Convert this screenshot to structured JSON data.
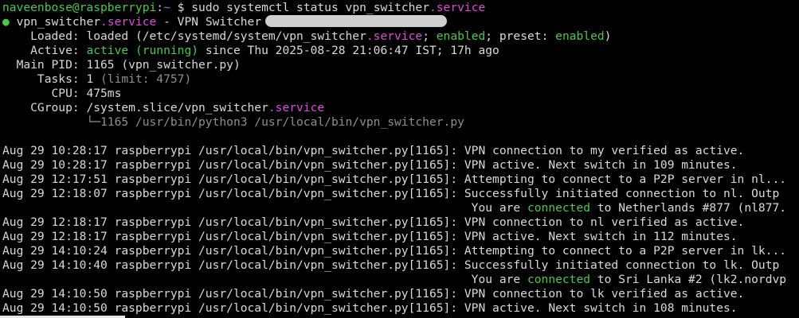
{
  "prompt": {
    "user_host": "naveenbose@raspberrypi",
    "separator": ":",
    "path": "~",
    "symbol": " $ ",
    "command": "sudo systemctl status vpn_switcher",
    "command_suffix": ".service"
  },
  "status": {
    "bullet": "●",
    "unit_name": " vpn_switcher",
    "unit_suffix": ".service",
    "description_prefix": " - VPN Switcher ",
    "loaded_label": "    Loaded: ",
    "loaded_text": "loaded (/etc/systemd/system/vpn_switcher",
    "loaded_suffix": ".service",
    "loaded_sep1": "; ",
    "loaded_enabled": "enabled",
    "loaded_sep2": "; preset: ",
    "loaded_preset": "enabled",
    "loaded_close": ")",
    "active_label": "    Active: ",
    "active_state": "active (running)",
    "active_since": " since Thu 2025-08-28 21:06:47 IST; 17h ago",
    "mainpid_label": "  Main PID: ",
    "mainpid_value": "1165 (vpn_switcher.py)",
    "tasks_label": "     Tasks: ",
    "tasks_value": "1",
    "tasks_limit": " (limit: 4757)",
    "cpu_label": "       CPU: ",
    "cpu_value": "475ms",
    "cgroup_label": "    CGroup: ",
    "cgroup_value": "/system.slice/vpn_switcher",
    "cgroup_suffix": ".service",
    "tree_line": "            └─1165 /usr/bin/python3 /usr/local/bin/vpn_switcher.py"
  },
  "logs": [
    {
      "prefix": "Aug 29 10:28:17 raspberrypi /usr/local/bin/vpn_switcher.py[1165]: ",
      "text": "VPN connection to my verified as active."
    },
    {
      "prefix": "Aug 29 10:28:17 raspberrypi /usr/local/bin/vpn_switcher.py[1165]: ",
      "text": "VPN active. Next switch in 109 minutes."
    },
    {
      "prefix": "Aug 29 12:17:51 raspberrypi /usr/local/bin/vpn_switcher.py[1165]: ",
      "text": "Attempting to connect to a P2P server in nl..."
    },
    {
      "prefix": "Aug 29 12:18:07 raspberrypi /usr/local/bin/vpn_switcher.py[1165]: ",
      "text": "Successfully initiated connection to nl. Outp"
    },
    {
      "cont_prefix": "                                                                   You are ",
      "cont_green": "connected",
      "cont_rest": " to Netherlands #877 (nl877."
    },
    {
      "prefix": "Aug 29 12:18:17 raspberrypi /usr/local/bin/vpn_switcher.py[1165]: ",
      "text": "VPN connection to nl verified as active."
    },
    {
      "prefix": "Aug 29 12:18:17 raspberrypi /usr/local/bin/vpn_switcher.py[1165]: ",
      "text": "VPN active. Next switch in 112 minutes."
    },
    {
      "prefix": "Aug 29 14:10:24 raspberrypi /usr/local/bin/vpn_switcher.py[1165]: ",
      "text": "Attempting to connect to a P2P server in lk..."
    },
    {
      "prefix": "Aug 29 14:10:40 raspberrypi /usr/local/bin/vpn_switcher.py[1165]: ",
      "text": "Successfully initiated connection to lk. Outp"
    },
    {
      "cont_prefix": "                                                                   You are ",
      "cont_green": "connected",
      "cont_rest": " to Sri Lanka #2 (lk2.nordvp"
    },
    {
      "prefix": "Aug 29 14:10:50 raspberrypi /usr/local/bin/vpn_switcher.py[1165]: ",
      "text": "VPN connection to lk verified as active."
    },
    {
      "prefix": "Aug 29 14:10:50 raspberrypi /usr/local/bin/vpn_switcher.py[1165]: ",
      "text": "VPN active. Next switch in 108 minutes."
    }
  ],
  "colors": {
    "background": "#000000",
    "foreground": "#d9d9d9",
    "green": "#4ec64e",
    "blue": "#4b8df0",
    "magenta": "#d94fd6",
    "dim": "#8f8f8f"
  }
}
